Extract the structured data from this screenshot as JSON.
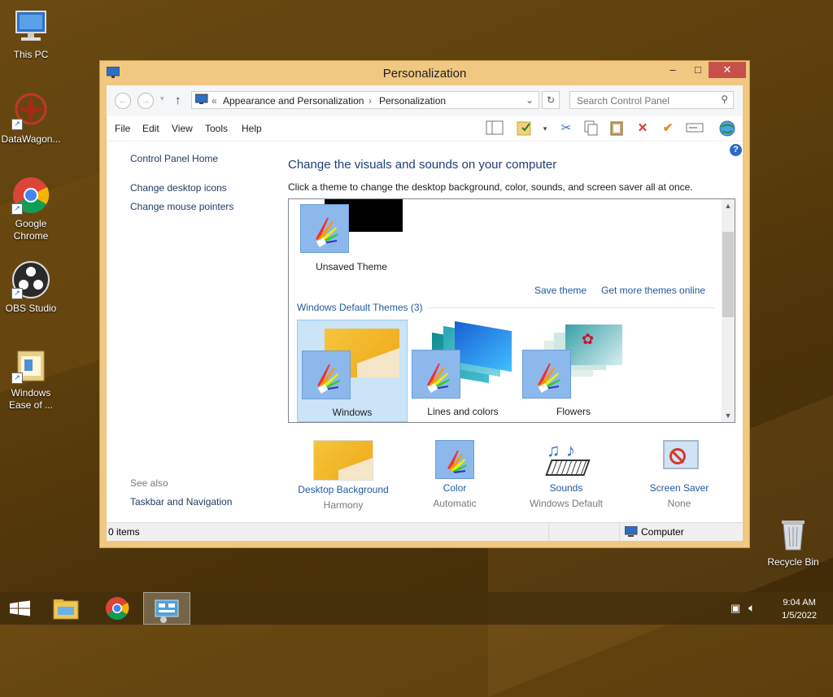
{
  "desktop": {
    "icons": [
      {
        "label": "This PC",
        "icon": "monitor-icon"
      },
      {
        "label": "DataWagon...",
        "icon": "datawagon-icon"
      },
      {
        "label": "Google Chrome",
        "icon": "chrome-icon"
      },
      {
        "label": "OBS Studio",
        "icon": "obs-icon"
      },
      {
        "label": "Windows Ease of ...",
        "icon": "folder-icon"
      },
      {
        "label": "Recycle Bin",
        "icon": "recycle-bin-icon"
      }
    ]
  },
  "window": {
    "title": "Personalization",
    "controls": {
      "minimize": "–",
      "maximize": "□",
      "close": "✕"
    }
  },
  "navigation": {
    "back": "←",
    "forward": "→",
    "up": "↑",
    "address_prefix": "«",
    "breadcrumbs": [
      "Appearance and Personalization",
      "Personalization"
    ],
    "separator": "›",
    "refresh": "↻",
    "search_placeholder": "Search Control Panel"
  },
  "menu": {
    "items": [
      "File",
      "Edit",
      "View",
      "Tools",
      "Help"
    ]
  },
  "sidebar": {
    "home": "Control Panel Home",
    "links": [
      "Change desktop icons",
      "Change mouse pointers"
    ],
    "see_also_label": "See also",
    "see_also_links": [
      "Taskbar and Navigation"
    ]
  },
  "main": {
    "heading": "Change the visuals and sounds on your computer",
    "subtext": "Click a theme to change the desktop background, color, sounds, and screen saver all at once.",
    "unsaved_theme": "Unsaved Theme",
    "save_theme": "Save theme",
    "get_more": "Get more themes online",
    "default_section": "Windows Default Themes (3)",
    "themes": [
      {
        "name": "Windows",
        "selected": true
      },
      {
        "name": "Lines and colors",
        "selected": false
      },
      {
        "name": "Flowers",
        "selected": false
      }
    ],
    "settings": [
      {
        "label": "Desktop Background",
        "value": "Harmony"
      },
      {
        "label": "Color",
        "value": "Automatic"
      },
      {
        "label": "Sounds",
        "value": "Windows Default"
      },
      {
        "label": "Screen Saver",
        "value": "None"
      }
    ]
  },
  "status": {
    "items": "0 items",
    "location": "Computer"
  },
  "taskbar": {
    "time": "9:04 AM",
    "date": "1/5/2022"
  },
  "colors": {
    "link": "#1e5aa0",
    "heading": "#1e3f73",
    "close": "#c7504a",
    "selection": "#cce4f7"
  }
}
